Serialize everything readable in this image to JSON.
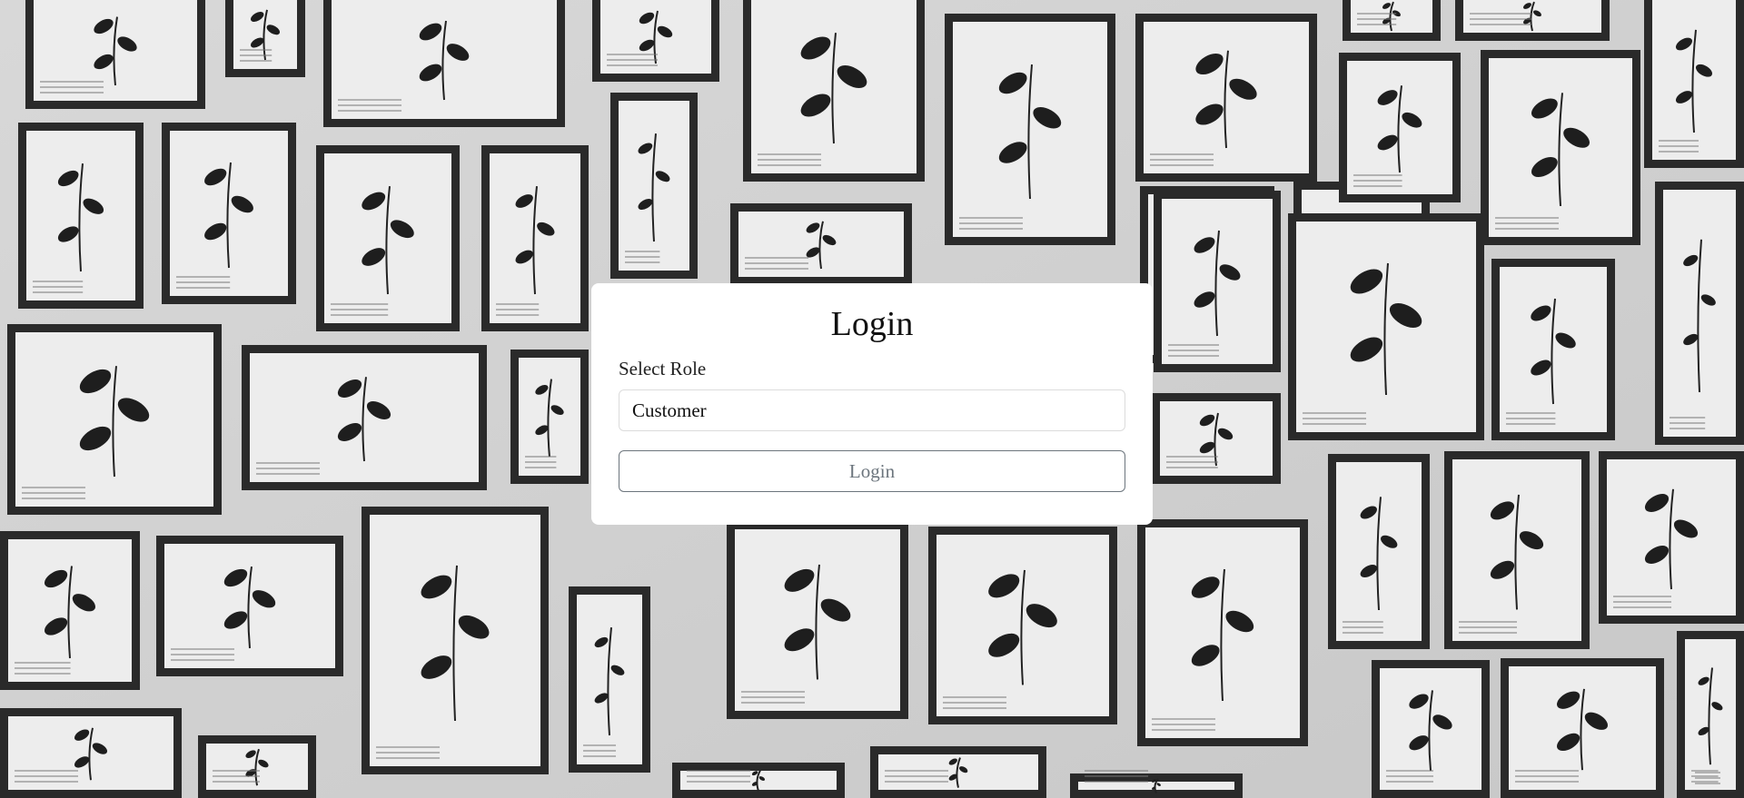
{
  "login": {
    "title": "Login",
    "role_label": "Select Role",
    "role_selected": "Customer",
    "button_label": "Login"
  },
  "theme": {
    "card_bg": "#ffffff",
    "button_border": "#6c757d",
    "button_text": "#6c757d"
  }
}
